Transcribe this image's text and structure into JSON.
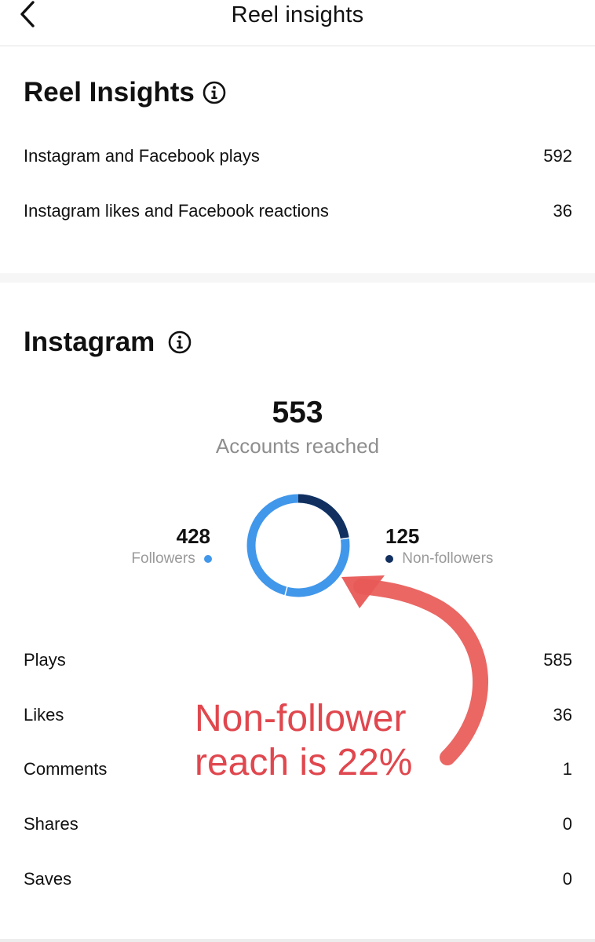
{
  "header": {
    "title": "Reel insights"
  },
  "reel_insights": {
    "title": "Reel Insights",
    "rows": [
      {
        "label": "Instagram and Facebook plays",
        "value": "592"
      },
      {
        "label": "Instagram likes and Facebook reactions",
        "value": "36"
      }
    ]
  },
  "instagram": {
    "title": "Instagram",
    "accounts_reached": {
      "value": "553",
      "label": "Accounts reached"
    },
    "followers": {
      "value": "428",
      "label": "Followers",
      "color": "#4197ea"
    },
    "non_followers": {
      "value": "125",
      "label": "Non-followers",
      "color": "#12305f"
    },
    "donut_non_follower_fraction": 0.226,
    "rows": [
      {
        "label": "Plays",
        "value": "585"
      },
      {
        "label": "Likes",
        "value": "36"
      },
      {
        "label": "Comments",
        "value": "1"
      },
      {
        "label": "Shares",
        "value": "0"
      },
      {
        "label": "Saves",
        "value": "0"
      }
    ]
  },
  "annotation": {
    "line1": "Non-follower",
    "line2": "reach is 22%",
    "color": "#e0474e"
  }
}
